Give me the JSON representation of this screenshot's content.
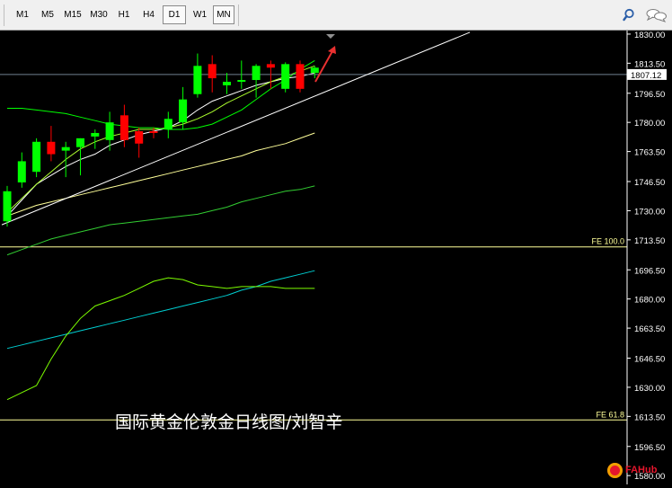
{
  "toolbar": {
    "timeframes": [
      {
        "label": "M1",
        "active": false
      },
      {
        "label": "M5",
        "active": false
      },
      {
        "label": "M15",
        "active": false
      },
      {
        "label": "M30",
        "active": false
      },
      {
        "label": "H1",
        "active": false
      },
      {
        "label": "H4",
        "active": false
      },
      {
        "label": "D1",
        "active": true
      },
      {
        "label": "W1",
        "active": false
      },
      {
        "label": "MN",
        "active": false
      }
    ],
    "icons": [
      "search-icon",
      "chat-icon"
    ]
  },
  "chart": {
    "current_price_label": "1807.12",
    "fe_labels": {
      "fe100": "FE 100.0",
      "fe618": "FE 61.8"
    },
    "watermark": "国际黄金伦敦金日线图/刘智辛",
    "logo_text": "FAHub",
    "colors": {
      "background": "#000000",
      "bull": "#00ff00",
      "bear": "#ff0000",
      "fe_line": "#ffff99",
      "price_line": "#708090",
      "trendline": "#ffffff",
      "arrow": "#e83030"
    }
  },
  "chart_data": {
    "type": "candlestick",
    "title": "",
    "xlabel": "",
    "ylabel": "",
    "ylim": [
      1575,
      1832
    ],
    "y_ticks": [
      "1830.00",
      "1813.50",
      "1796.50",
      "1780.00",
      "1763.50",
      "1746.50",
      "1730.00",
      "1713.50",
      "1696.50",
      "1680.00",
      "1663.50",
      "1646.50",
      "1630.00",
      "1613.50",
      "1596.50",
      "1580.00"
    ],
    "candles": [
      {
        "o": 1724,
        "h": 1744,
        "l": 1721,
        "c": 1741
      },
      {
        "o": 1746,
        "h": 1763,
        "l": 1743,
        "c": 1758
      },
      {
        "o": 1752,
        "h": 1771,
        "l": 1749,
        "c": 1769
      },
      {
        "o": 1769,
        "h": 1778,
        "l": 1758,
        "c": 1762
      },
      {
        "o": 1764,
        "h": 1769,
        "l": 1749,
        "c": 1766
      },
      {
        "o": 1766,
        "h": 1771,
        "l": 1750,
        "c": 1771
      },
      {
        "o": 1772,
        "h": 1776,
        "l": 1765,
        "c": 1774
      },
      {
        "o": 1770,
        "h": 1786,
        "l": 1764,
        "c": 1780
      },
      {
        "o": 1784,
        "h": 1790,
        "l": 1766,
        "c": 1770
      },
      {
        "o": 1775,
        "h": 1777,
        "l": 1760,
        "c": 1768
      },
      {
        "o": 1775,
        "h": 1777,
        "l": 1771,
        "c": 1774
      },
      {
        "o": 1776,
        "h": 1786,
        "l": 1771,
        "c": 1782
      },
      {
        "o": 1780,
        "h": 1800,
        "l": 1776,
        "c": 1793
      },
      {
        "o": 1796,
        "h": 1819,
        "l": 1794,
        "c": 1812
      },
      {
        "o": 1813,
        "h": 1818,
        "l": 1797,
        "c": 1805
      },
      {
        "o": 1801,
        "h": 1808,
        "l": 1796,
        "c": 1803
      },
      {
        "o": 1803,
        "h": 1815,
        "l": 1799,
        "c": 1804
      },
      {
        "o": 1804,
        "h": 1813,
        "l": 1794,
        "c": 1812
      },
      {
        "o": 1813,
        "h": 1815,
        "l": 1799,
        "c": 1811
      },
      {
        "o": 1799,
        "h": 1814,
        "l": 1797,
        "c": 1813
      },
      {
        "o": 1813,
        "h": 1815,
        "l": 1797,
        "c": 1799
      },
      {
        "o": 1808,
        "h": 1812,
        "l": 1805,
        "c": 1811
      }
    ],
    "moving_averages": [
      {
        "color": "#ffffff",
        "values": [
          1727,
          1736,
          1745,
          1750,
          1755,
          1759,
          1762,
          1767,
          1770,
          1773,
          1775,
          1777,
          1781,
          1787,
          1792,
          1795,
          1798,
          1801,
          1803,
          1805,
          1806,
          1808
        ]
      },
      {
        "color": "#adff2f",
        "values": [
          1729,
          1737,
          1745,
          1752,
          1759,
          1765,
          1769,
          1772,
          1774,
          1776,
          1776,
          1777,
          1779,
          1782,
          1786,
          1791,
          1795,
          1799,
          1803,
          1806,
          1809,
          1812
        ]
      },
      {
        "color": "#00ff00",
        "values": [
          1788,
          1788,
          1787,
          1786,
          1785,
          1783,
          1781,
          1779,
          1778,
          1777,
          1777,
          1776,
          1776,
          1777,
          1779,
          1783,
          1787,
          1793,
          1799,
          1804,
          1810,
          1815
        ]
      },
      {
        "color": "#ffff99",
        "values": [
          1727,
          1730,
          1733,
          1735,
          1737,
          1739,
          1741,
          1743,
          1745,
          1747,
          1749,
          1751,
          1753,
          1755,
          1757,
          1759,
          1761,
          1764,
          1766,
          1768,
          1771,
          1774
        ]
      },
      {
        "color": "#32cd32",
        "values": [
          1705,
          1708,
          1711,
          1714,
          1716,
          1718,
          1720,
          1722,
          1723,
          1724,
          1725,
          1726,
          1727,
          1728,
          1730,
          1732,
          1735,
          1737,
          1739,
          1741,
          1742,
          1744
        ]
      },
      {
        "color": "#00ced1",
        "values": [
          1652,
          1654,
          1656,
          1658,
          1660,
          1662,
          1664,
          1666,
          1668,
          1670,
          1672,
          1674,
          1676,
          1678,
          1680,
          1682,
          1685,
          1687,
          1690,
          1692,
          1694,
          1696
        ]
      },
      {
        "color": "#7cfc00",
        "values": [
          1623,
          1627,
          1631,
          1646,
          1659,
          1669,
          1676,
          1679,
          1682,
          1686,
          1690,
          1692,
          1691,
          1688,
          1687,
          1686,
          1687,
          1687,
          1687,
          1686,
          1686,
          1686
        ]
      }
    ],
    "levels": [
      {
        "label": "FE 100.0",
        "value": 1709.5
      },
      {
        "label": "FE 61.8",
        "value": 1611.5
      }
    ],
    "current_price": 1807.12
  }
}
